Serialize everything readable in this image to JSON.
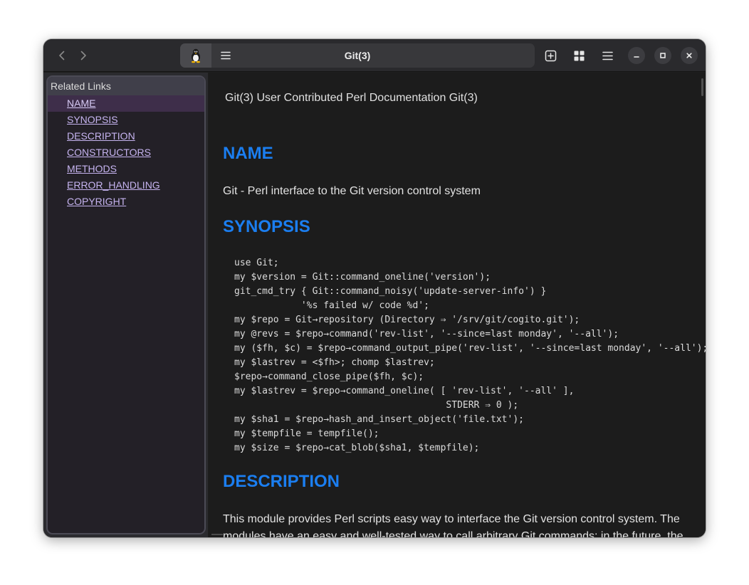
{
  "window": {
    "title": "Git(3)"
  },
  "icons": {
    "back": "chevron-left-icon",
    "forward": "chevron-right-icon",
    "app": "tux-penguin-icon",
    "menu": "hamburger-menu-icon",
    "new_tab": "plus-square-icon",
    "grid": "grid-icon",
    "main_menu": "hamburger-menu-icon",
    "minimize": "minimize-icon",
    "maximize": "maximize-icon",
    "close": "close-icon"
  },
  "sidebar": {
    "heading": "Related Links",
    "items": [
      {
        "label": "NAME",
        "active": true
      },
      {
        "label": "SYNOPSIS",
        "active": false
      },
      {
        "label": "DESCRIPTION",
        "active": false
      },
      {
        "label": "CONSTRUCTORS",
        "active": false
      },
      {
        "label": "METHODS",
        "active": false
      },
      {
        "label": "ERROR_HANDLING",
        "active": false
      },
      {
        "label": "COPYRIGHT",
        "active": false
      }
    ]
  },
  "content": {
    "header": "Git(3) User Contributed Perl Documentation Git(3)",
    "sections": {
      "name": {
        "title": "NAME",
        "text": "Git - Perl interface to the Git version control system"
      },
      "synopsis": {
        "title": "SYNOPSIS",
        "code": "use Git;\nmy $version = Git::command_oneline('version');\ngit_cmd_try { Git::command_noisy('update-server-info') }\n            '%s failed w/ code %d';\nmy $repo = Git→repository (Directory ⇒ '/srv/git/cogito.git');\nmy @revs = $repo→command('rev-list', '--since=last monday', '--all');\nmy ($fh, $c) = $repo→command_output_pipe('rev-list', '--since=last monday', '--all');\nmy $lastrev = <$fh>; chomp $lastrev;\n$repo→command_close_pipe($fh, $c);\nmy $lastrev = $repo→command_oneline( [ 'rev-list', '--all' ],\n                                      STDERR ⇒ 0 );\nmy $sha1 = $repo→hash_and_insert_object('file.txt');\nmy $tempfile = tempfile();\nmy $size = $repo→cat_blob($sha1, $tempfile);"
      },
      "description": {
        "title": "DESCRIPTION",
        "text": "This module provides Perl scripts easy way to interface the Git version control system. The modules have an easy and well-tested way to call arbitrary Git commands; in the future, the"
      }
    }
  },
  "colors": {
    "accent": "#1b7ef0",
    "link": "#c5b3ef",
    "window_bg": "#1e1e1e",
    "sidebar_bg": "#232027"
  }
}
